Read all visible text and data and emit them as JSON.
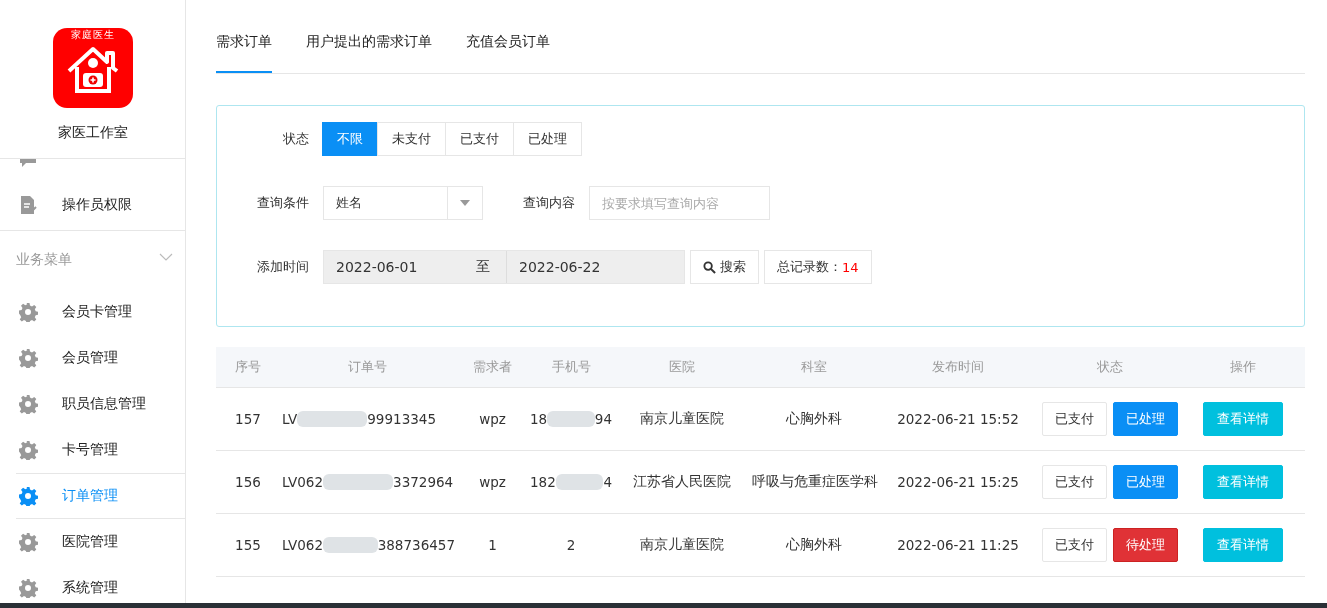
{
  "sidebar": {
    "logo_text": "家庭医生",
    "app_name": "家医工作室",
    "items": [
      {
        "kind": "chat",
        "selected": false
      },
      {
        "label": "操作员权限",
        "kind": "doc",
        "selected": false
      }
    ],
    "section": {
      "label": "业务菜单",
      "expanded": true
    },
    "menu": [
      {
        "label": "会员卡管理",
        "selected": false
      },
      {
        "label": "会员管理",
        "selected": false
      },
      {
        "label": "职员信息管理",
        "selected": false
      },
      {
        "label": "卡号管理",
        "selected": false
      },
      {
        "label": "订单管理",
        "selected": true
      },
      {
        "label": "医院管理",
        "selected": false
      },
      {
        "label": "系统管理",
        "selected": false
      }
    ]
  },
  "tabs": [
    {
      "label": "需求订单",
      "selected": true
    },
    {
      "label": "用户提出的需求订单",
      "selected": false
    },
    {
      "label": "充值会员订单",
      "selected": false
    }
  ],
  "filters": {
    "status_label": "状态",
    "status_options": [
      {
        "label": "不限",
        "selected": true
      },
      {
        "label": "未支付",
        "selected": false
      },
      {
        "label": "已支付",
        "selected": false
      },
      {
        "label": "已处理",
        "selected": false
      }
    ],
    "condition_label": "查询条件",
    "condition_value": "姓名",
    "content_label": "查询内容",
    "content_placeholder": "按要求填写查询内容",
    "time_label": "添加时间",
    "date_from": "2022-06-01",
    "date_sep": "至",
    "date_to": "2022-06-22",
    "search_button": "搜索",
    "total_label": "总记录数：",
    "total_value": "14"
  },
  "table": {
    "columns": [
      "序号",
      "订单号",
      "需求者",
      "手机号",
      "医院",
      "科室",
      "发布时间",
      "状态",
      "操作"
    ],
    "rows": [
      {
        "no": "157",
        "order_start": "LV",
        "order_end": "99913345",
        "requester": "wpz",
        "phone_start": "18",
        "phone_end": "94",
        "hospital": "南京儿童医院",
        "department": "心胸外科",
        "time": "2022-06-21 15:52",
        "pay_status": "已支付",
        "handle": {
          "label": "已处理",
          "kind": "done"
        },
        "action": "查看详情"
      },
      {
        "no": "156",
        "order_start": "LV062",
        "order_end": "3372964",
        "requester": "wpz",
        "phone_start": "182",
        "phone_end": "4",
        "hospital": "江苏省人民医院",
        "department": "呼吸与危重症医学科",
        "time": "2022-06-21 15:25",
        "pay_status": "已支付",
        "handle": {
          "label": "已处理",
          "kind": "done"
        },
        "action": "查看详情"
      },
      {
        "no": "155",
        "order_start": "LV062",
        "order_end": "388736457",
        "requester": "1",
        "phone_start": "2",
        "hospital": "南京儿童医院",
        "department": "心胸外科",
        "time": "2022-06-21 11:25",
        "pay_status": "已支付",
        "handle": {
          "label": "待处理",
          "kind": "pending"
        },
        "action": "查看详情"
      }
    ]
  }
}
